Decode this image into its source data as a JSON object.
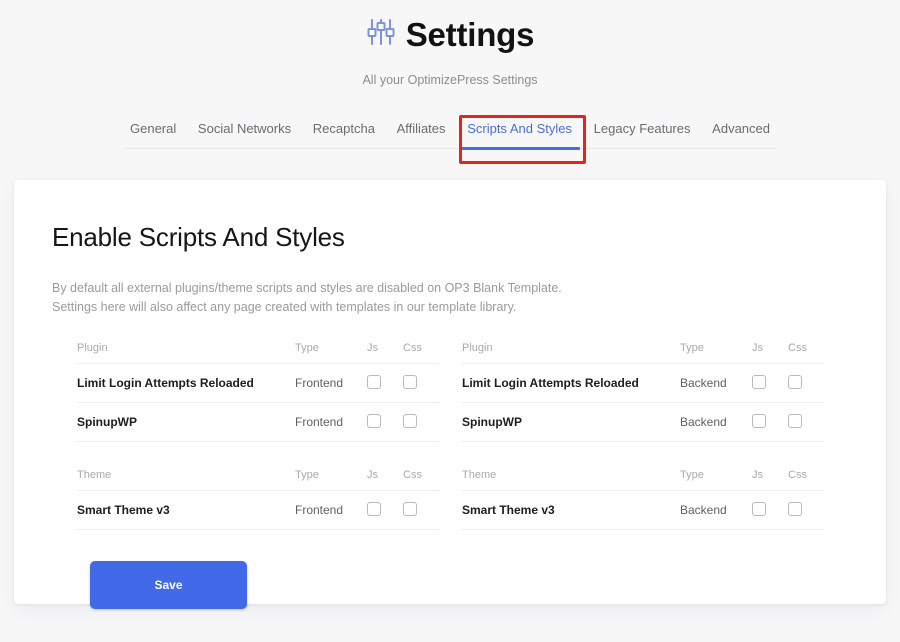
{
  "header": {
    "icon": "sliders-icon",
    "title": "Settings",
    "subtitle": "All your OptimizePress Settings"
  },
  "tabs": [
    {
      "label": "General",
      "active": false
    },
    {
      "label": "Social Networks",
      "active": false
    },
    {
      "label": "Recaptcha",
      "active": false
    },
    {
      "label": "Affiliates",
      "active": false
    },
    {
      "label": "Scripts And Styles",
      "active": true
    },
    {
      "label": "Legacy Features",
      "active": false
    },
    {
      "label": "Advanced",
      "active": false
    }
  ],
  "annotation": {
    "color": "#e8231e",
    "target": "Scripts And Styles"
  },
  "colors": {
    "accent": "#4a6fd4",
    "save_button": "#4169e8",
    "annotation_red": "#e8231e",
    "page_background": "#f7f7f8",
    "card_background": "#ffffff"
  },
  "main": {
    "section_title": "Enable Scripts And Styles",
    "description_line1": "By default all external plugins/theme scripts and styles are disabled on OP3 Blank Template.",
    "description_line2": "Settings here will also affect any page created with templates in our template library.",
    "tables": [
      {
        "plugin": {
          "headers": [
            "Plugin",
            "Type",
            "Js",
            "Css"
          ],
          "rows": [
            {
              "name": "Limit Login Attempts Reloaded",
              "type": "Frontend",
              "js": false,
              "css": false
            },
            {
              "name": "SpinupWP",
              "type": "Frontend",
              "js": false,
              "css": false
            }
          ]
        },
        "theme": {
          "headers": [
            "Theme",
            "Type",
            "Js",
            "Css"
          ],
          "rows": [
            {
              "name": "Smart Theme v3",
              "type": "Frontend",
              "js": false,
              "css": false
            }
          ]
        }
      },
      {
        "plugin": {
          "headers": [
            "Plugin",
            "Type",
            "Js",
            "Css"
          ],
          "rows": [
            {
              "name": "Limit Login Attempts Reloaded",
              "type": "Backend",
              "js": false,
              "css": false
            },
            {
              "name": "SpinupWP",
              "type": "Backend",
              "js": false,
              "css": false
            }
          ]
        },
        "theme": {
          "headers": [
            "Theme",
            "Type",
            "Js",
            "Css"
          ],
          "rows": [
            {
              "name": "Smart Theme v3",
              "type": "Backend",
              "js": false,
              "css": false
            }
          ]
        }
      }
    ],
    "save_label": "Save"
  }
}
